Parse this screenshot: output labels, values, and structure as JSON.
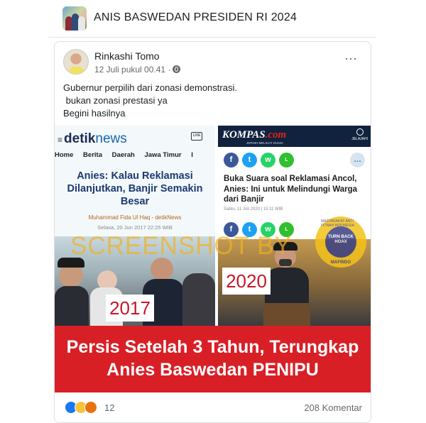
{
  "group": {
    "title": "ANIS BASWEDAN PRESIDEN RI 2024"
  },
  "post": {
    "author": "Rinkashi Tomo",
    "timestamp": "12 Juli pukul 00.41 ·",
    "privacy_icon": "globe-icon",
    "text": "Gubernur perpilih dari zonasi demonstrasi.\n bukan zonasi prestasi ya\nBegini hasilnya",
    "more_icon": "⋯"
  },
  "image": {
    "left_panel": {
      "logo_main": "detik",
      "logo_sub": "news",
      "live_label": "LIVE",
      "nav": [
        "Home",
        "Berita",
        "Daerah",
        "Jawa Timur",
        "I"
      ],
      "headline": "Anies: Kalau Reklamasi Dilanjutkan, Banjir Semakin Besar",
      "author": "Muhammad Fida Ul Haq - detikNews",
      "date": "Selasa, 20 Jun 2017 22:25 WIB",
      "year": "2017"
    },
    "right_panel": {
      "logo": "KOMPAS",
      "logo_suffix": ".com",
      "tagline": "JERNIH MELIHAT DUNIA",
      "jelajahi": "JELAJAHI",
      "headline": "Buka Suara soal Reklamasi Ancol, Anies: Ini untuk Melindungi Warga dari Banjir",
      "date": "Sabtu, 11 Juli 2020 | 15:11 WIB",
      "year": "2020"
    },
    "watermark": "SCREENSHOT BY",
    "stamp": {
      "top": "MASYARAKAT ANTI FITNAH INDONESIA",
      "center": "TURN BACK HOAX",
      "bottom": "MAFINDO"
    },
    "banner_line1": "Persis Setelah 3 Tahun, Terungkap",
    "banner_line2": "Anies Baswedan PENIPU",
    "colors": {
      "banner": "#d91f26",
      "kompas": "#11223f",
      "detik": "#1566b0"
    }
  },
  "footer": {
    "reaction_icons": [
      "like-icon",
      "haha-icon",
      "angry-icon"
    ],
    "reaction_count": "12",
    "comments": "208 Komentar"
  }
}
